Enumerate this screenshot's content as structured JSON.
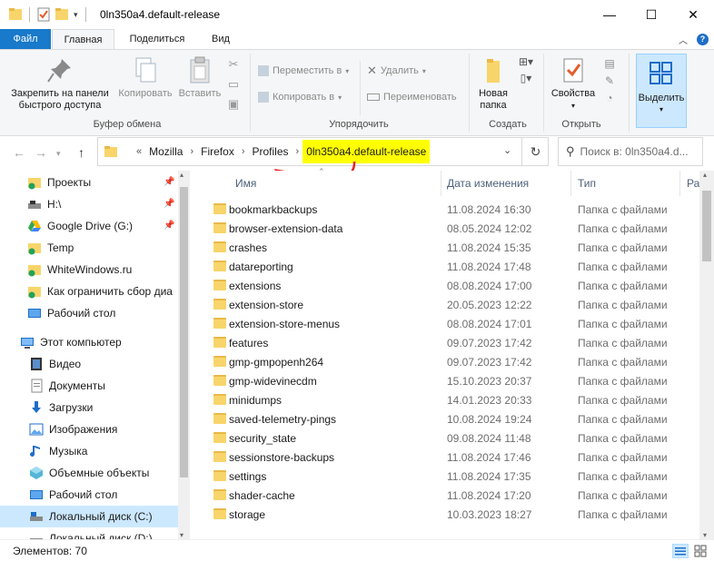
{
  "window": {
    "title": "0ln350a4.default-release",
    "controls": {
      "minimize": "—",
      "maximize": "☐",
      "close": "✕"
    }
  },
  "tabs": {
    "file": "Файл",
    "home": "Главная",
    "share": "Поделиться",
    "view": "Вид"
  },
  "ribbon": {
    "pin": "Закрепить на панели быстрого доступа",
    "pin_line1": "Закрепить на панели",
    "pin_line2": "быстрого доступа",
    "copy": "Копировать",
    "paste": "Вставить",
    "clipboard_group": "Буфер обмена",
    "move_to": "Переместить в",
    "copy_to": "Копировать в",
    "delete": "Удалить",
    "rename": "Переименовать",
    "organize_group": "Упорядочить",
    "new_folder_line1": "Новая",
    "new_folder_line2": "папка",
    "create_group": "Создать",
    "properties": "Свойства",
    "open_group": "Открыть",
    "select": "Выделить"
  },
  "address": {
    "overflow": "«",
    "crumbs": [
      "Mozilla",
      "Firefox",
      "Profiles"
    ],
    "current": "0ln350a4.default-release",
    "search_placeholder": "Поиск в: 0ln350a4.d..."
  },
  "nav": {
    "quick": [
      {
        "label": "Проекты",
        "icon": "folder-green-icon",
        "pinned": true
      },
      {
        "label": "H:\\",
        "icon": "drive-icon",
        "pinned": true
      },
      {
        "label": "Google Drive (G:)",
        "icon": "google-drive-icon",
        "pinned": true
      },
      {
        "label": "Temp",
        "icon": "folder-green-icon",
        "pinned": false
      },
      {
        "label": "WhiteWindows.ru",
        "icon": "folder-green-icon",
        "pinned": false
      },
      {
        "label": "Как ограничить сбор диа",
        "icon": "folder-green-icon",
        "pinned": false
      },
      {
        "label": "Рабочий стол",
        "icon": "desktop-icon",
        "pinned": false
      }
    ],
    "this_pc": "Этот компьютер",
    "pc_items": [
      {
        "label": "Видео",
        "icon": "video-icon"
      },
      {
        "label": "Документы",
        "icon": "documents-icon"
      },
      {
        "label": "Загрузки",
        "icon": "downloads-icon"
      },
      {
        "label": "Изображения",
        "icon": "pictures-icon"
      },
      {
        "label": "Музыка",
        "icon": "music-icon"
      },
      {
        "label": "Объемные объекты",
        "icon": "3d-objects-icon"
      },
      {
        "label": "Рабочий стол",
        "icon": "desktop-icon"
      },
      {
        "label": "Локальный диск (C:)",
        "icon": "local-disk-icon",
        "selected": true
      },
      {
        "label": "Локальный диск (D:)",
        "icon": "local-disk-icon"
      }
    ]
  },
  "columns": {
    "name": "Имя",
    "date": "Дата изменения",
    "type": "Тип",
    "size": "Ра"
  },
  "files": [
    {
      "name": "bookmarkbackups",
      "date": "11.08.2024 16:30",
      "type": "Папка с файлами"
    },
    {
      "name": "browser-extension-data",
      "date": "08.05.2024 12:02",
      "type": "Папка с файлами"
    },
    {
      "name": "crashes",
      "date": "11.08.2024 15:35",
      "type": "Папка с файлами"
    },
    {
      "name": "datareporting",
      "date": "11.08.2024 17:48",
      "type": "Папка с файлами"
    },
    {
      "name": "extensions",
      "date": "08.08.2024 17:00",
      "type": "Папка с файлами"
    },
    {
      "name": "extension-store",
      "date": "20.05.2023 12:22",
      "type": "Папка с файлами"
    },
    {
      "name": "extension-store-menus",
      "date": "08.08.2024 17:01",
      "type": "Папка с файлами"
    },
    {
      "name": "features",
      "date": "09.07.2023 17:42",
      "type": "Папка с файлами"
    },
    {
      "name": "gmp-gmpopenh264",
      "date": "09.07.2023 17:42",
      "type": "Папка с файлами"
    },
    {
      "name": "gmp-widevinecdm",
      "date": "15.10.2023 20:37",
      "type": "Папка с файлами"
    },
    {
      "name": "minidumps",
      "date": "14.01.2023 20:33",
      "type": "Папка с файлами"
    },
    {
      "name": "saved-telemetry-pings",
      "date": "10.08.2024 19:24",
      "type": "Папка с файлами"
    },
    {
      "name": "security_state",
      "date": "09.08.2024 11:48",
      "type": "Папка с файлами"
    },
    {
      "name": "sessionstore-backups",
      "date": "11.08.2024 17:46",
      "type": "Папка с файлами"
    },
    {
      "name": "settings",
      "date": "11.08.2024 17:35",
      "type": "Папка с файлами"
    },
    {
      "name": "shader-cache",
      "date": "11.08.2024 17:20",
      "type": "Папка с файлами"
    },
    {
      "name": "storage",
      "date": "10.03.2023 18:27",
      "type": "Папка с файлами"
    }
  ],
  "status": {
    "items": "Элементов: 70"
  },
  "colors": {
    "accent": "#1979ca",
    "highlight": "#ffff00",
    "arrow": "#e8202a",
    "selection": "#cce8ff"
  }
}
